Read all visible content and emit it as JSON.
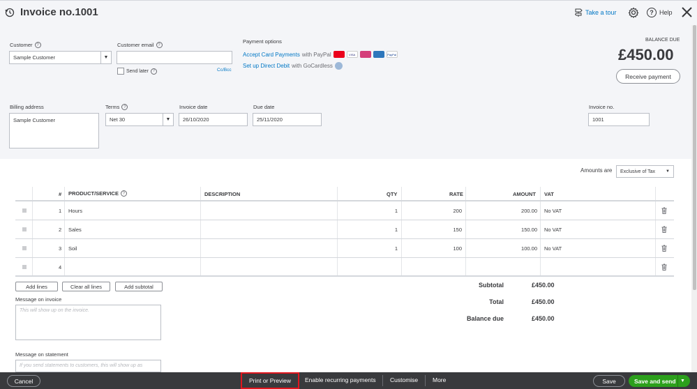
{
  "header": {
    "title": "Invoice no.1001",
    "take_tour": "Take a tour",
    "help": "Help"
  },
  "customer": {
    "label": "Customer",
    "value": "Sample Customer"
  },
  "email": {
    "label": "Customer email",
    "value": "",
    "send_later": "Send later",
    "cc_bcc": "Cc/Bcc"
  },
  "payment": {
    "label": "Payment options",
    "line1_link": "Accept Card Payments",
    "line1_rest": " with PayPal",
    "line2_link": "Set up Direct Debit",
    "line2_rest": " with GoCardless"
  },
  "balance": {
    "label": "BALANCE DUE",
    "amount": "£450.00",
    "receive": "Receive payment"
  },
  "billing": {
    "label": "Billing address",
    "value": "Sample Customer"
  },
  "terms": {
    "label": "Terms",
    "value": "Net 30"
  },
  "invoice_date": {
    "label": "Invoice date",
    "value": "26/10/2020"
  },
  "due_date": {
    "label": "Due date",
    "value": "25/11/2020"
  },
  "invoice_no": {
    "label": "Invoice no.",
    "value": "1001"
  },
  "amounts_are": {
    "label": "Amounts are",
    "value": "Exclusive of Tax"
  },
  "table": {
    "headers": {
      "num": "#",
      "product": "PRODUCT/SERVICE",
      "description": "DESCRIPTION",
      "qty": "QTY",
      "rate": "RATE",
      "amount": "AMOUNT",
      "vat": "VAT"
    },
    "rows": [
      {
        "num": "1",
        "product": "Hours",
        "description": "",
        "qty": "1",
        "rate": "200",
        "amount": "200.00",
        "vat": "No VAT"
      },
      {
        "num": "2",
        "product": "Sales",
        "description": "",
        "qty": "1",
        "rate": "150",
        "amount": "150.00",
        "vat": "No VAT"
      },
      {
        "num": "3",
        "product": "Soil",
        "description": "",
        "qty": "1",
        "rate": "100",
        "amount": "100.00",
        "vat": "No VAT"
      },
      {
        "num": "4",
        "product": "",
        "description": "",
        "qty": "",
        "rate": "",
        "amount": "",
        "vat": ""
      }
    ]
  },
  "actions": {
    "add_lines": "Add lines",
    "clear_all": "Clear all lines",
    "add_subtotal": "Add subtotal"
  },
  "totals": {
    "subtotal_label": "Subtotal",
    "subtotal": "£450.00",
    "total_label": "Total",
    "total": "£450.00",
    "balance_label": "Balance due",
    "balance": "£450.00"
  },
  "message_invoice": {
    "label": "Message on invoice",
    "placeholder": "This will show up on the invoice."
  },
  "message_statement": {
    "label": "Message on statement",
    "placeholder": "If you send statements to customers, this will show up as"
  },
  "footer": {
    "cancel": "Cancel",
    "print": "Print or Preview",
    "recurring": "Enable recurring payments",
    "customise": "Customise",
    "more": "More",
    "save": "Save",
    "save_send": "Save and send"
  },
  "colors": {
    "accent_blue": "#0077c5",
    "save_green": "#2ca01c",
    "footer_dark": "#393a3d",
    "highlight_red": "#e0161e"
  }
}
